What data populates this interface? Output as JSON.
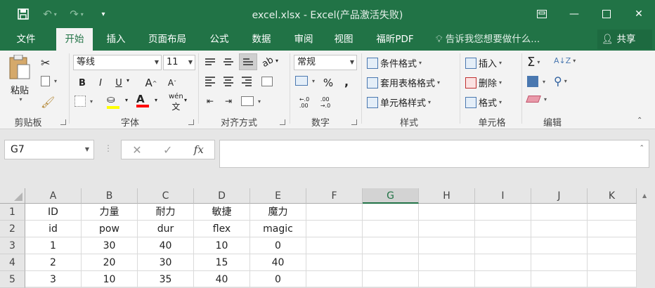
{
  "window": {
    "title": "excel.xlsx - Excel(产品激活失败)",
    "minimize_icon": "minimize-icon",
    "restore_icon": "restore-icon",
    "close_icon": "close-icon"
  },
  "qat": {
    "save": "save-icon",
    "undo": "undo-icon",
    "redo": "redo-icon",
    "customize": "customize-icon"
  },
  "tabs": [
    "文件",
    "开始",
    "插入",
    "页面布局",
    "公式",
    "数据",
    "审阅",
    "视图",
    "福昕PDF"
  ],
  "active_tab": "开始",
  "tellme": "告诉我您想要做什么...",
  "share": "共享",
  "ribbon": {
    "clipboard": {
      "paste": "粘贴",
      "label": "剪贴板"
    },
    "font": {
      "name": "等线",
      "size": "11",
      "label": "字体",
      "bold": "B",
      "italic": "I",
      "underline": "U",
      "grow": "A",
      "shrink": "A",
      "phonetic": "wén"
    },
    "alignment": {
      "label": "对齐方式"
    },
    "number": {
      "format": "常规",
      "label": "数字",
      "percent": "%",
      "comma": ",",
      "inc": "←.0 .00",
      "dec": ".00 →.0"
    },
    "styles": {
      "conditional": "条件格式",
      "table": "套用表格格式",
      "cell": "单元格样式",
      "label": "样式"
    },
    "cells": {
      "insert": "插入",
      "delete": "删除",
      "format": "格式",
      "label": "单元格"
    },
    "editing": {
      "label": "编辑"
    }
  },
  "formula_bar": {
    "name_box": "G7",
    "cancel": "✕",
    "enter": "✓",
    "fx": "fx",
    "content": ""
  },
  "grid": {
    "columns": [
      "A",
      "B",
      "C",
      "D",
      "E",
      "F",
      "G",
      "H",
      "I",
      "J",
      "K"
    ],
    "selected_column": "G",
    "rows": [
      {
        "n": "1",
        "cells": [
          "ID",
          "力量",
          "耐力",
          "敏捷",
          "魔力"
        ]
      },
      {
        "n": "2",
        "cells": [
          "id",
          "pow",
          "dur",
          "flex",
          "magic"
        ]
      },
      {
        "n": "3",
        "cells": [
          "1",
          "30",
          "40",
          "10",
          "0"
        ]
      },
      {
        "n": "4",
        "cells": [
          "2",
          "20",
          "30",
          "15",
          "40"
        ]
      },
      {
        "n": "5",
        "cells": [
          "3",
          "10",
          "35",
          "40",
          "0"
        ]
      }
    ]
  }
}
